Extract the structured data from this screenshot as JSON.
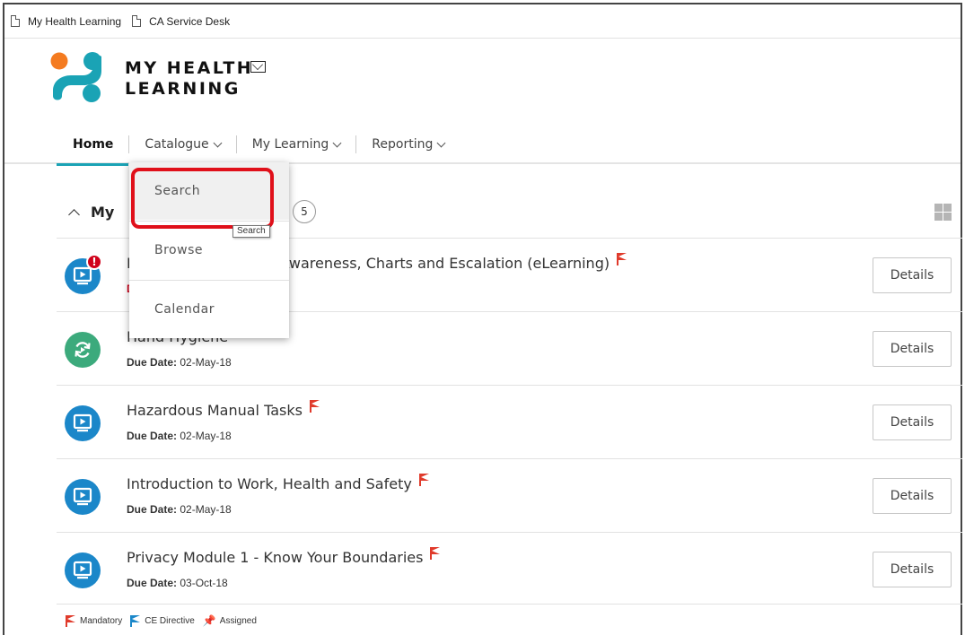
{
  "bookmarks": [
    {
      "label": "My Health Learning"
    },
    {
      "label": "CA Service Desk"
    }
  ],
  "brand": {
    "line1": "MY HEALTH",
    "line2": "LEARNING"
  },
  "nav": {
    "home": "Home",
    "catalogue": "Catalogue",
    "my_learning": "My Learning",
    "reporting": "Reporting"
  },
  "dropdown": {
    "items": [
      {
        "label": "Search"
      },
      {
        "label": "Browse"
      },
      {
        "label": "Calendar"
      }
    ],
    "tooltip": "Search"
  },
  "section": {
    "title": "My",
    "count": "5"
  },
  "learning_items": [
    {
      "title": "E... Tier 1: Awareness, Charts and Escalation (eLearning)",
      "title_visible": "ier 1: Awareness, Charts and Escalation (eLearning)",
      "due_label": "D",
      "due_value": "",
      "icon": "elearning-icon",
      "overdue": true,
      "button": "Details"
    },
    {
      "title": "Hand Hygiene",
      "due_label": "Due Date:",
      "due_value": "02-May-18",
      "icon": "refresh-icon",
      "button": "Details"
    },
    {
      "title": "Hazardous Manual Tasks",
      "due_label": "Due Date:",
      "due_value": "02-May-18",
      "icon": "elearning-icon",
      "button": "Details"
    },
    {
      "title": "Introduction to Work, Health and Safety",
      "due_label": "Due Date:",
      "due_value": "02-May-18",
      "icon": "elearning-icon",
      "button": "Details"
    },
    {
      "title": "Privacy Module 1 - Know Your Boundaries",
      "due_label": "Due Date:",
      "due_value": "03-Oct-18",
      "icon": "elearning-icon",
      "button": "Details"
    }
  ],
  "legend": {
    "mandatory": "Mandatory",
    "ce_directive": "CE Directive",
    "assigned": "Assigned"
  },
  "colors": {
    "accent": "#1aa3b5",
    "icon_blue": "#1b87c9",
    "icon_green": "#3caa7c",
    "flag_red": "#e03a2b",
    "highlight": "#e0101a"
  }
}
